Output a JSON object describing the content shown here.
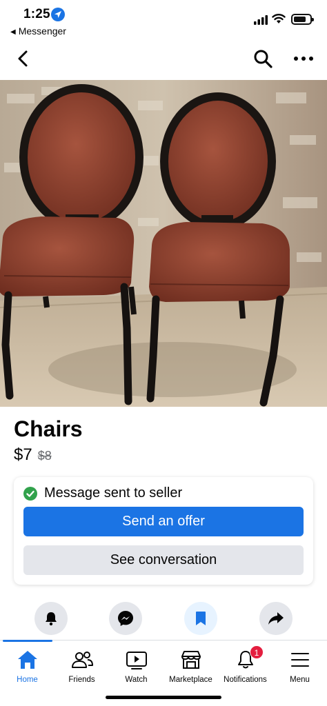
{
  "status_bar": {
    "time": "1:25",
    "back_app": "Messenger"
  },
  "nav": {
    "back_icon": "chevron-left-icon",
    "search_icon": "search-icon",
    "more_icon": "more-horizontal-icon"
  },
  "listing": {
    "title": "Chairs",
    "price": "$7",
    "original_price": "$8",
    "photo": "two-brown-leather-chairs"
  },
  "message_card": {
    "status": "Message sent to seller",
    "offer_label": "Send an offer",
    "conversation_label": "See conversation"
  },
  "actions": [
    "bell-icon",
    "messenger-icon",
    "bookmark-icon",
    "share-icon"
  ],
  "tabs": [
    {
      "label": "Home",
      "icon": "home-icon",
      "active": true
    },
    {
      "label": "Friends",
      "icon": "friends-icon"
    },
    {
      "label": "Watch",
      "icon": "watch-icon"
    },
    {
      "label": "Marketplace",
      "icon": "marketplace-icon"
    },
    {
      "label": "Notifications",
      "icon": "bell-icon",
      "badge": "1"
    },
    {
      "label": "Menu",
      "icon": "menu-icon"
    }
  ],
  "colors": {
    "accent": "#1b74e4",
    "success": "#31a24c",
    "badge": "#e41e3f"
  }
}
